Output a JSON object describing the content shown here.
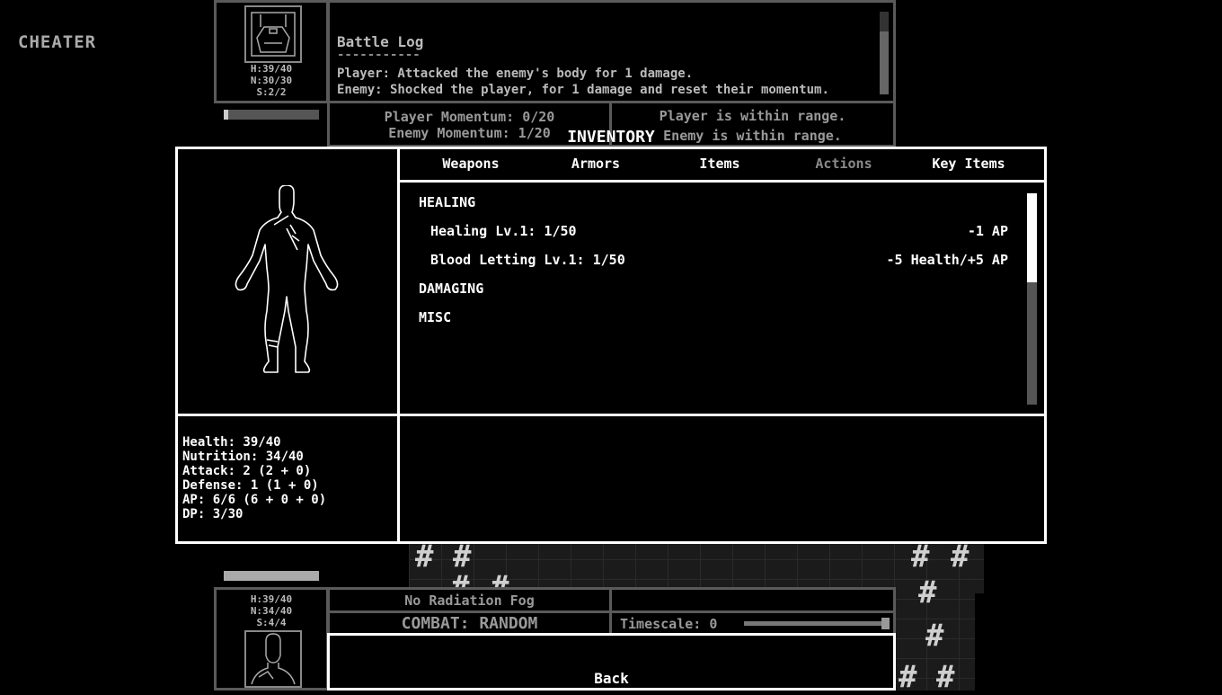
{
  "cheater_label": "CHEATER",
  "enemy": {
    "health": "H:39/40",
    "nutrition": "N:30/30",
    "stamina": "S:2/2",
    "momentum_fill": 0.05
  },
  "battle_log": {
    "title": "Battle Log",
    "divider": "-----------",
    "lines": [
      "Player: Attacked the enemy's body for 1 damage.",
      "Enemy: Shocked the player, for 1 damage and reset their momentum."
    ]
  },
  "momentum": {
    "player": "Player Momentum: 0/20",
    "enemy": "Enemy Momentum: 1/20"
  },
  "range": {
    "player": "Player is within range.",
    "enemy": "Enemy is within range."
  },
  "inventory": {
    "title": "INVENTORY",
    "tabs": [
      "Weapons",
      "Armors",
      "Items",
      "Actions",
      "Key Items"
    ],
    "active_tab": "Actions",
    "categories": {
      "healing": "HEALING",
      "damaging": "DAMAGING",
      "misc": "MISC"
    },
    "entries": [
      {
        "name": "Healing Lv.1: 1/50",
        "cost": "-1 AP"
      },
      {
        "name": "Blood Letting Lv.1: 1/50",
        "cost": "-5 Health/+5 AP"
      }
    ],
    "stats": [
      "Health: 39/40",
      "Nutrition: 34/40",
      "Attack: 2 (2 + 0)",
      "Defense: 1 (1 + 0)",
      "AP: 6/6 (6 + 0 + 0)",
      "DP: 3/30"
    ]
  },
  "player": {
    "health": "H:39/40",
    "nutrition": "N:34/40",
    "stamina": "S:4/4"
  },
  "status": {
    "fog": "No Radiation Fog",
    "combat": "COMBAT: RANDOM",
    "timescale": "Timescale: 0"
  },
  "back_label": "Back",
  "hash_glyph": "#"
}
